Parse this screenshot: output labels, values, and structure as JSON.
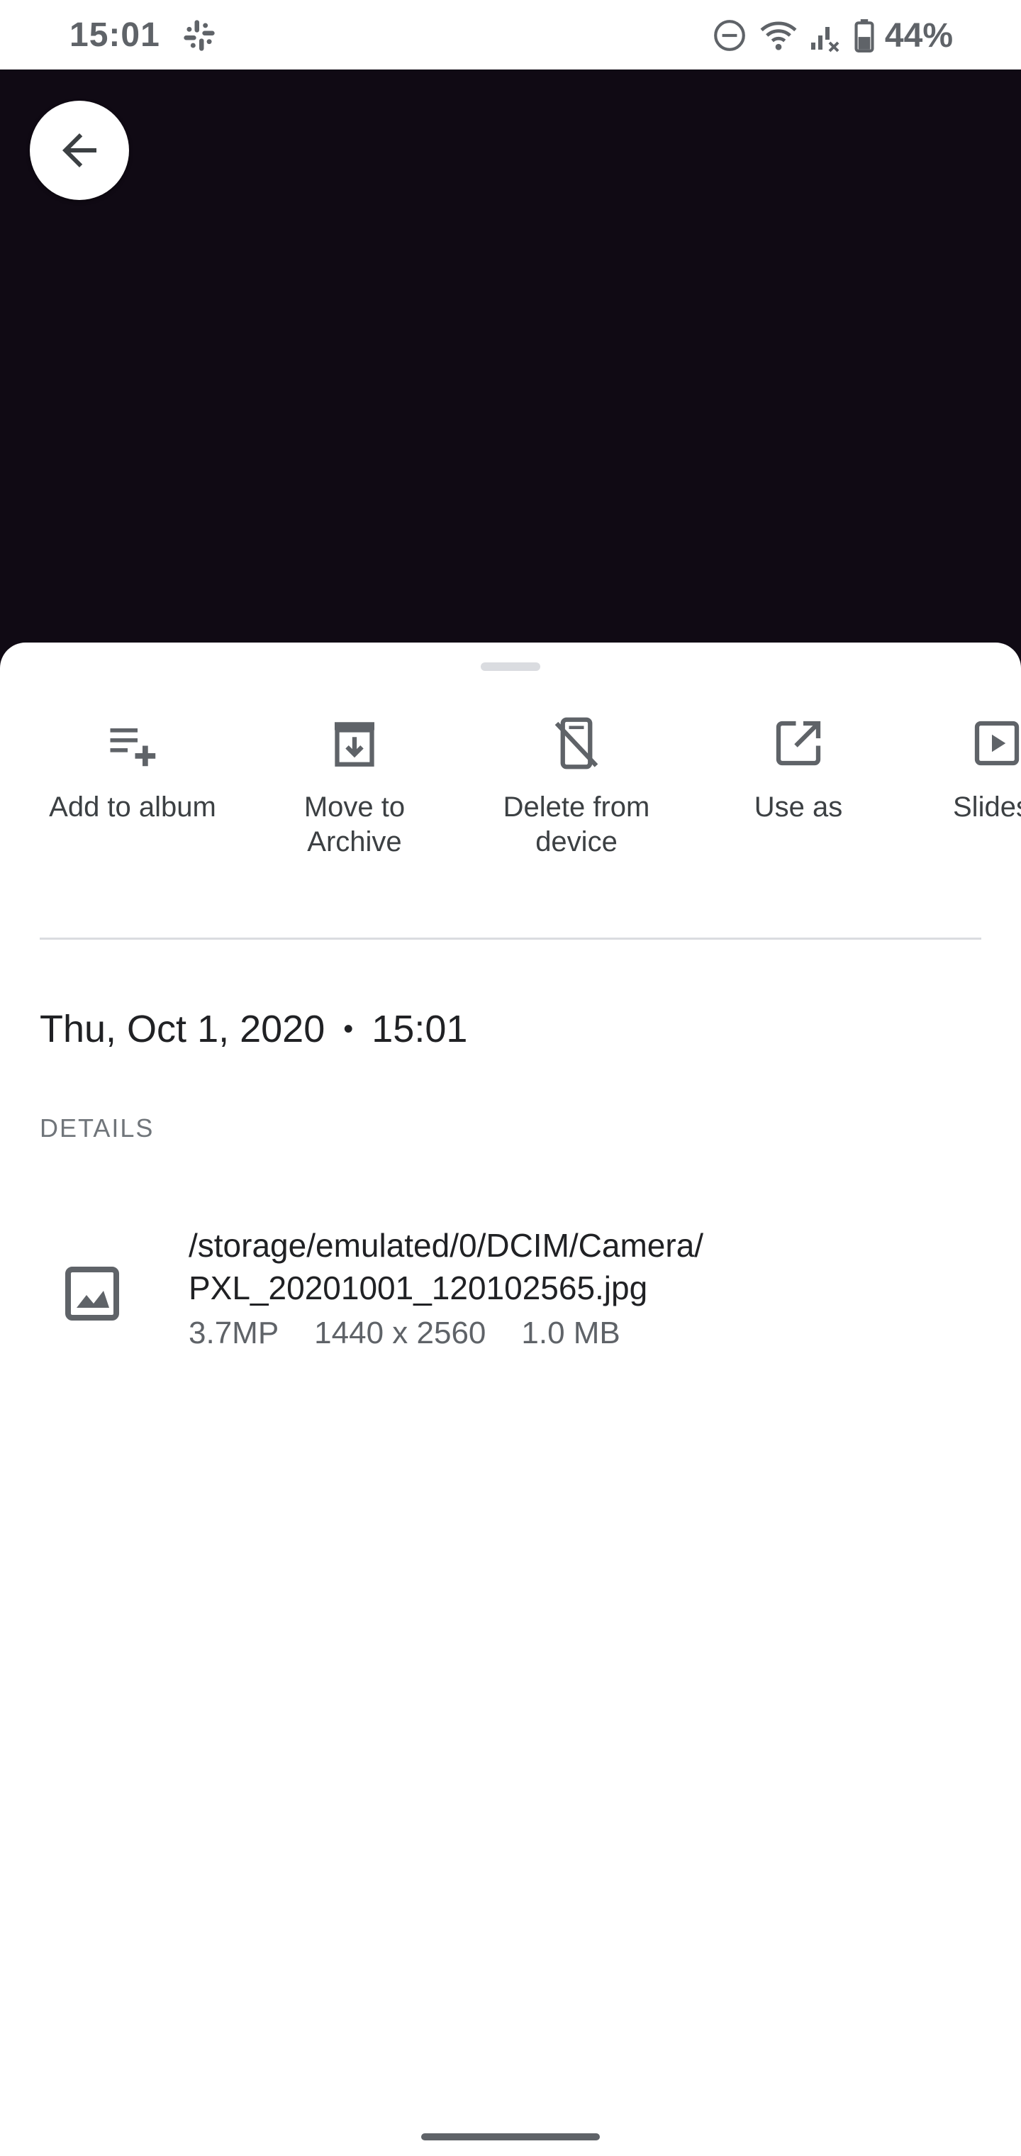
{
  "status_bar": {
    "time": "15:01",
    "notification_icon": "slack-icon",
    "icons": [
      "do-not-disturb-icon",
      "wifi-icon",
      "signal-icon",
      "battery-icon"
    ],
    "battery_percent": "44%"
  },
  "photo": {
    "background_color": "#100a14"
  },
  "back_button": {
    "icon": "arrow-back-icon"
  },
  "actions": [
    {
      "label": "Add to album",
      "icon": "playlist-add-icon"
    },
    {
      "label": "Move to\nArchive",
      "icon": "archive-icon"
    },
    {
      "label": "Delete from\ndevice",
      "icon": "delete-from-device-icon"
    },
    {
      "label": "Use as",
      "icon": "open-in-new-icon"
    },
    {
      "label": "Slides",
      "icon": "slideshow-icon"
    }
  ],
  "date": {
    "day": "Thu, Oct 1, 2020",
    "separator": "•",
    "time": "15:01"
  },
  "details": {
    "heading": "DETAILS",
    "file": {
      "icon": "image-icon",
      "path": "/storage/emulated/0/DCIM/Camera/\nPXL_20201001_120102565.jpg",
      "megapixels": "3.7MP",
      "resolution": "1440 x 2560",
      "size": "1.0 MB"
    }
  },
  "colors": {
    "icon_gray": "#5f6368",
    "text_dark": "#202124",
    "divider": "#dadce0"
  }
}
